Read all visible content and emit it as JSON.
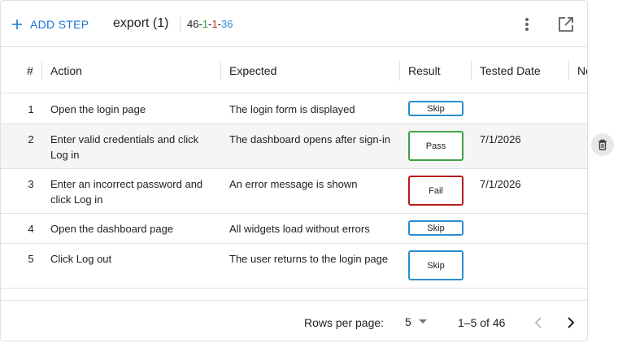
{
  "toolbar": {
    "add_step_label": "ADD STEP",
    "title": "export (1)",
    "counts": {
      "total": "46",
      "sep": "-",
      "pass": "1",
      "fail": "1",
      "skip": "36"
    },
    "more_icon": "more-vert-icon",
    "open_icon": "open-in-new-icon"
  },
  "table": {
    "columns": {
      "num": "#",
      "action": "Action",
      "expected": "Expected",
      "result": "Result",
      "date": "Tested Date",
      "notes": "No"
    },
    "rows": [
      {
        "num": "1",
        "action": "Open the login page",
        "expected": "The login form is displayed",
        "result": "Skip",
        "date": ""
      },
      {
        "num": "2",
        "action": "Enter valid credentials and click Log in",
        "expected": "The dashboard opens after sign-in",
        "result": "Pass",
        "date": "7/1/2026"
      },
      {
        "num": "3",
        "action": "Enter an incorrect password and click Log in",
        "expected": "An error message is shown",
        "result": "Fail",
        "date": "7/1/2026"
      },
      {
        "num": "4",
        "action": "Open the dashboard page",
        "expected": "All widgets load without errors",
        "result": "Skip",
        "date": ""
      },
      {
        "num": "5",
        "action": "Click Log out",
        "expected": "The user returns to the login page",
        "result": "Skip",
        "date": ""
      }
    ]
  },
  "footer": {
    "rows_per_page_label": "Rows per page:",
    "rows_per_page_value": "5",
    "range": "1–5 of 46"
  },
  "colors": {
    "accent": "#1976d2",
    "pass": "#43a047",
    "fail": "#b71c1c",
    "skip": "#2a8fcf"
  },
  "icons": {
    "add": "plus-icon",
    "delete": "trash-icon",
    "prev": "chevron-left-icon",
    "next": "chevron-right-icon",
    "dropdown": "caret-down-icon"
  }
}
